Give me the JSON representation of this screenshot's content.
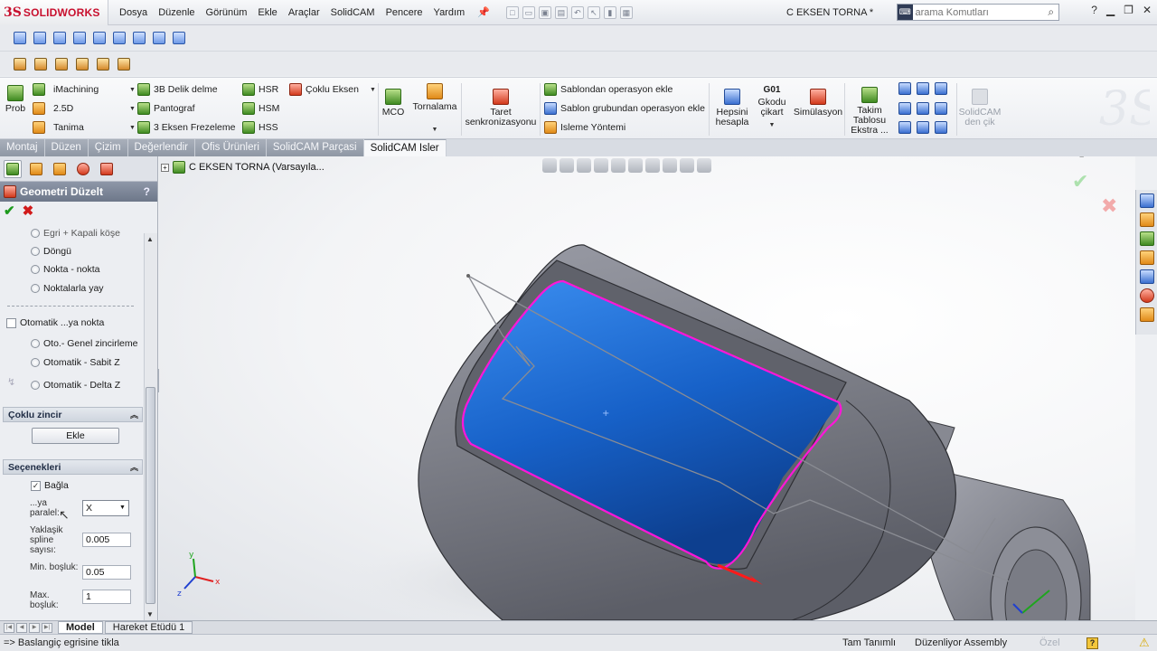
{
  "app": {
    "brand_ds": "3S",
    "brand_name": "SOLIDWORKS",
    "document_title": "C EKSEN TORNA *",
    "menu": [
      "Dosya",
      "Düzenle",
      "Görünüm",
      "Ekle",
      "Araçlar",
      "SolidCAM",
      "Pencere",
      "Yardım"
    ],
    "search_placeholder": "arama Komutları"
  },
  "ribbon": {
    "prob": "Prob",
    "imachining": "iMachining",
    "d25": "2.5D",
    "tanima": "Tanima",
    "delme3b": "3B Delik delme",
    "pantograf": "Pantograf",
    "frezeleme3": "3 Eksen Frezeleme",
    "hsr": "HSR",
    "hsm": "HSM",
    "hss": "HSS",
    "coklu_eksen": "Çoklu Eksen",
    "mco": "MCO",
    "tornalama": "Tornalama",
    "taret_1": "Taret",
    "taret_2": "senkronizasyonu",
    "sablondan": "Sablondan operasyon ekle",
    "sablon_grup": "Sablon grubundan operasyon ekle",
    "isleme": "Isleme Yöntemi",
    "hepsini_1": "Hepsini",
    "hepsini_2": "hesapla",
    "gkodu_top": "G01",
    "gkodu_1": "Gkodu",
    "gkodu_2": "çikart",
    "simulasyon": "Simülasyon",
    "takim_1": "Takim",
    "takim_2": "Tablosu",
    "takim_3": "Ekstra ...",
    "solidcam_cik_1": "SolidCAM",
    "solidcam_cik_2": "den çik"
  },
  "tabs": [
    {
      "label": "Montaj",
      "active": false
    },
    {
      "label": "Düzen",
      "active": false
    },
    {
      "label": "Çizim",
      "active": false
    },
    {
      "label": "Değerlendir",
      "active": false
    },
    {
      "label": "Ofis Ürünleri",
      "active": false
    },
    {
      "label": "SolidCAM Parçasi",
      "active": false
    },
    {
      "label": "SolidCAM Isler",
      "active": true
    }
  ],
  "panel": {
    "title": "Geometri Düzelt",
    "help": "?",
    "options_top": {
      "partial": "Egri + Kapali köşe",
      "dongu": "Döngü",
      "nokta": "Nokta - nokta",
      "yay": "Noktalarla yay"
    },
    "otomatik": "Otomatik ...ya nokta",
    "otomatik_options": {
      "genel": "Oto.- Genel zincirleme",
      "sabit": "Otomatik - Sabit Z",
      "delta": "Otomatik - Delta Z"
    },
    "coklu_zincir": "Çoklu zincir",
    "ekle": "Ekle",
    "secenekleri": "Seçenekleri",
    "bagla": "Bağla",
    "ya_paralel_1": "...ya",
    "ya_paralel_2": "paralel:",
    "axis_value": "X",
    "yaklasik_1": "Yaklaşik",
    "yaklasik_2": "spline",
    "yaklasik_3": "sayısı:",
    "yaklasik_value": "0.005",
    "min_bosluk": "Min. boşluk:",
    "min_value": "0.05",
    "max_1": "Max.",
    "max_2": "boşluk:",
    "max_value": "1"
  },
  "viewport": {
    "tree_label": "C EKSEN TORNA  (Varsayıla..."
  },
  "bottom_tabs": [
    {
      "label": "Model",
      "active": true
    },
    {
      "label": "Hareket Etüdü 1",
      "active": false
    }
  ],
  "status": {
    "message": "=> Baslangiç egrisine tikla",
    "s1": "Tam Tanımlı",
    "s2": "Düzenliyor Assembly",
    "s3": "Özel",
    "help": "?"
  },
  "colors": {
    "brand_red": "#c8102e",
    "face_blue": "#1e63c8",
    "magenta_edge": "#ff16d8",
    "part_grey": "#8e9099",
    "ok_green": "#1d9a1d",
    "cancel_red": "#d11a1a"
  }
}
